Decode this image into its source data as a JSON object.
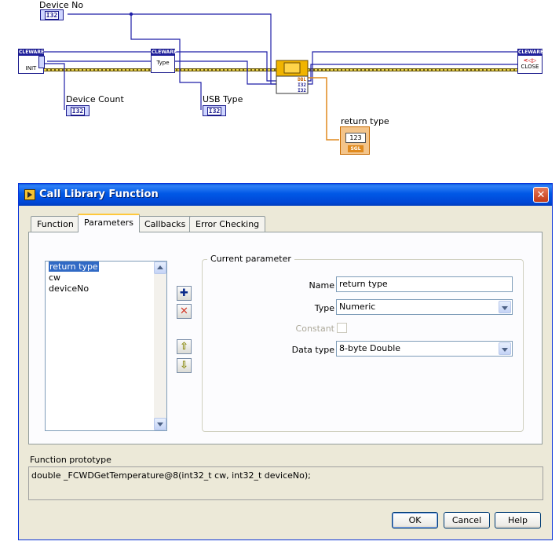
{
  "diagram": {
    "device_no_label": "Device No",
    "device_count_label": "Device Count",
    "usb_type_label": "USB Type",
    "return_type_label": "return type",
    "i32": "I32",
    "numeric_value": "123",
    "sgl": "SGL",
    "init_vi": {
      "brand": "CLEWARE",
      "label": "INIT"
    },
    "type_vi": {
      "brand": "CLEWARE",
      "label": "Type"
    },
    "close_vi": {
      "brand": "CLEWARE",
      "label": "CLOSE"
    },
    "clfn_terminals": {
      "top_right": "DBL",
      "row1": "I32",
      "row2": "I32"
    }
  },
  "dialog": {
    "title": "Call Library Function",
    "tabs": [
      {
        "label": "Function"
      },
      {
        "label": "Parameters"
      },
      {
        "label": "Callbacks"
      },
      {
        "label": "Error Checking"
      }
    ],
    "active_tab": "Parameters",
    "parameters": [
      "return type",
      "cw",
      "deviceNo"
    ],
    "selected_parameter": "return type",
    "group_title": "Current parameter",
    "fields": {
      "name_label": "Name",
      "name_value": "return type",
      "type_label": "Type",
      "type_value": "Numeric",
      "constant_label": "Constant",
      "data_type_label": "Data type",
      "data_type_value": "8-byte Double"
    },
    "prototype_label": "Function prototype",
    "prototype": "double _FCWDGetTemperature@8(int32_t cw, int32_t deviceNo);",
    "buttons": {
      "ok": "OK",
      "cancel": "Cancel",
      "help": "Help"
    }
  },
  "colors": {
    "title_bar": "#0054e3",
    "dialog_bg": "#ece9d8",
    "wire_i32": "#1f1fa8",
    "wire_error": "#b8a020",
    "wire_dbl": "#e08a1e",
    "selection": "#316ac5"
  },
  "icons": [
    "add-plus-icon",
    "delete-x-icon",
    "move-up-icon",
    "move-down-icon",
    "close-icon",
    "app-icon"
  ]
}
